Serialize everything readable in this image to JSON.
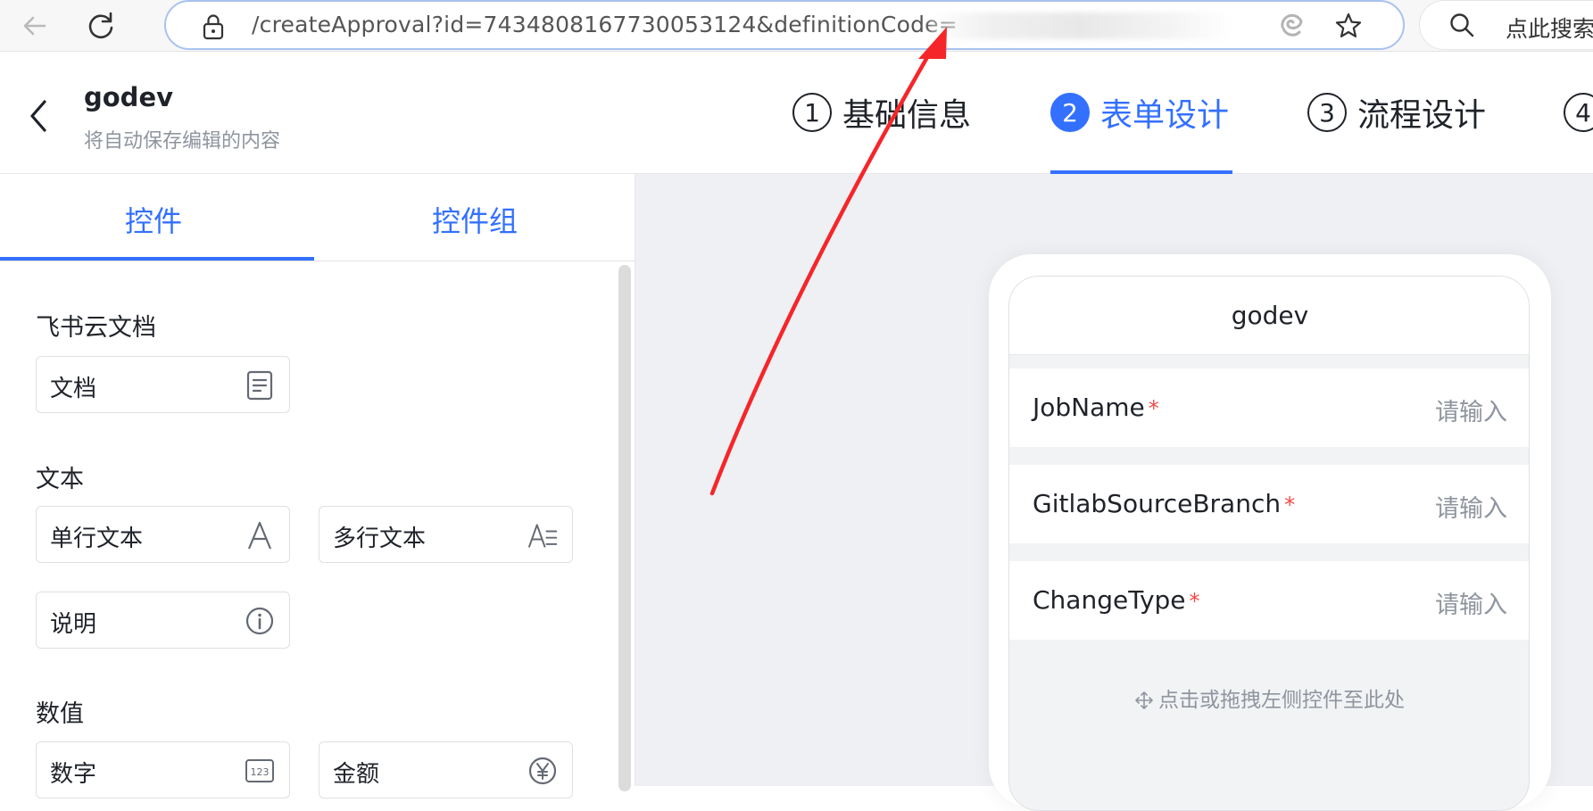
{
  "browser": {
    "url": "/createApproval?id=7434808167730053124&definitionCode=",
    "search_placeholder": "点此搜索"
  },
  "header": {
    "title": "godev",
    "subtitle": "将自动保存编辑的内容",
    "steps": [
      {
        "num": "1",
        "label": "基础信息",
        "active": false
      },
      {
        "num": "2",
        "label": "表单设计",
        "active": true
      },
      {
        "num": "3",
        "label": "流程设计",
        "active": false
      },
      {
        "num": "4",
        "label": "",
        "active": false
      }
    ]
  },
  "left_panel": {
    "tabs": [
      "控件",
      "控件组"
    ],
    "sections": [
      {
        "title": "飞书云文档",
        "widgets": [
          {
            "label": "文档",
            "icon": "document-icon"
          }
        ]
      },
      {
        "title": "文本",
        "widgets": [
          {
            "label": "单行文本",
            "icon": "single-line-text-icon"
          },
          {
            "label": "多行文本",
            "icon": "multi-line-text-icon"
          },
          {
            "label": "说明",
            "icon": "info-icon"
          }
        ]
      },
      {
        "title": "数值",
        "widgets": [
          {
            "label": "数字",
            "icon": "number-123-icon"
          },
          {
            "label": "金额",
            "icon": "yuan-icon"
          }
        ]
      }
    ]
  },
  "form_preview": {
    "title": "godev",
    "fields": [
      {
        "label": "JobName",
        "required_mark": "*",
        "placeholder": "请输入"
      },
      {
        "label": "GitlabSourceBranch",
        "required_mark": "*",
        "placeholder": "请输入"
      },
      {
        "label": "ChangeType",
        "required_mark": "*",
        "placeholder": "请输入"
      }
    ],
    "drop_hint": "点击或拖拽左侧控件至此处"
  },
  "colors": {
    "accent": "#3370ff",
    "required": "#f54a45",
    "annotation_arrow": "#f5262a"
  }
}
